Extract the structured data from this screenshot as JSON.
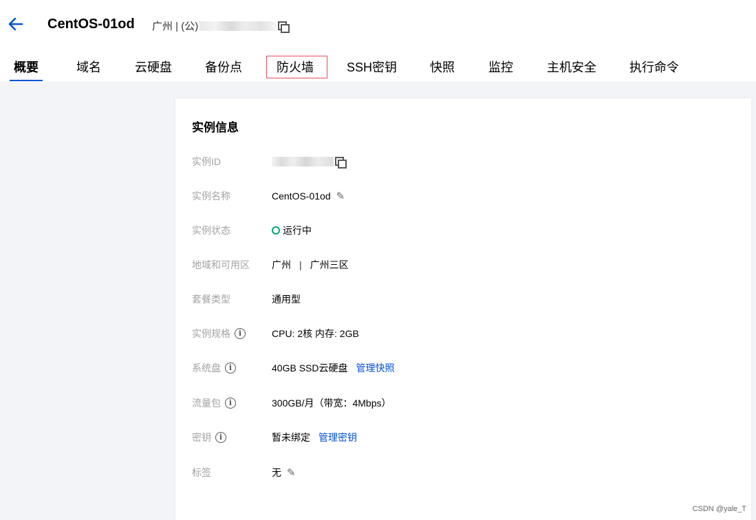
{
  "header": {
    "title": "CentOS-01od",
    "region_prefix": "广州 | (公)"
  },
  "tabs": [
    {
      "label": "概要",
      "active": true
    },
    {
      "label": "域名"
    },
    {
      "label": "云硬盘"
    },
    {
      "label": "备份点"
    },
    {
      "label": "防火墙",
      "highlighted": true
    },
    {
      "label": "SSH密钥"
    },
    {
      "label": "快照"
    },
    {
      "label": "监控"
    },
    {
      "label": "主机安全"
    },
    {
      "label": "执行命令"
    }
  ],
  "card": {
    "title": "实例信息",
    "rows": {
      "instance_id": {
        "label": "实例ID"
      },
      "instance_name": {
        "label": "实例名称",
        "value": "CentOS-01od"
      },
      "instance_status": {
        "label": "实例状态",
        "value": "运行中"
      },
      "region": {
        "label": "地域和可用区",
        "city": "广州",
        "separator": "|",
        "zone": "广州三区"
      },
      "plan_type": {
        "label": "套餐类型",
        "value": "通用型"
      },
      "spec": {
        "label": "实例规格",
        "value": "CPU: 2核 内存: 2GB"
      },
      "system_disk": {
        "label": "系统盘",
        "value": "40GB SSD云硬盘",
        "link": "管理快照"
      },
      "traffic": {
        "label": "流量包",
        "value": "300GB/月（带宽：4Mbps）"
      },
      "key": {
        "label": "密钥",
        "value": "暂未绑定",
        "link": "管理密钥"
      },
      "tags": {
        "label": "标签",
        "value": "无"
      }
    }
  },
  "watermark": "CSDN @yale_T",
  "colors": {
    "accent": "#0052d9",
    "status_running": "#00a870",
    "highlight_box": "#e34d59",
    "label_gray": "#a3a3a3"
  },
  "icons": [
    "back-arrow-icon",
    "copy-icon",
    "edit-icon",
    "info-icon",
    "status-dot-icon"
  ]
}
